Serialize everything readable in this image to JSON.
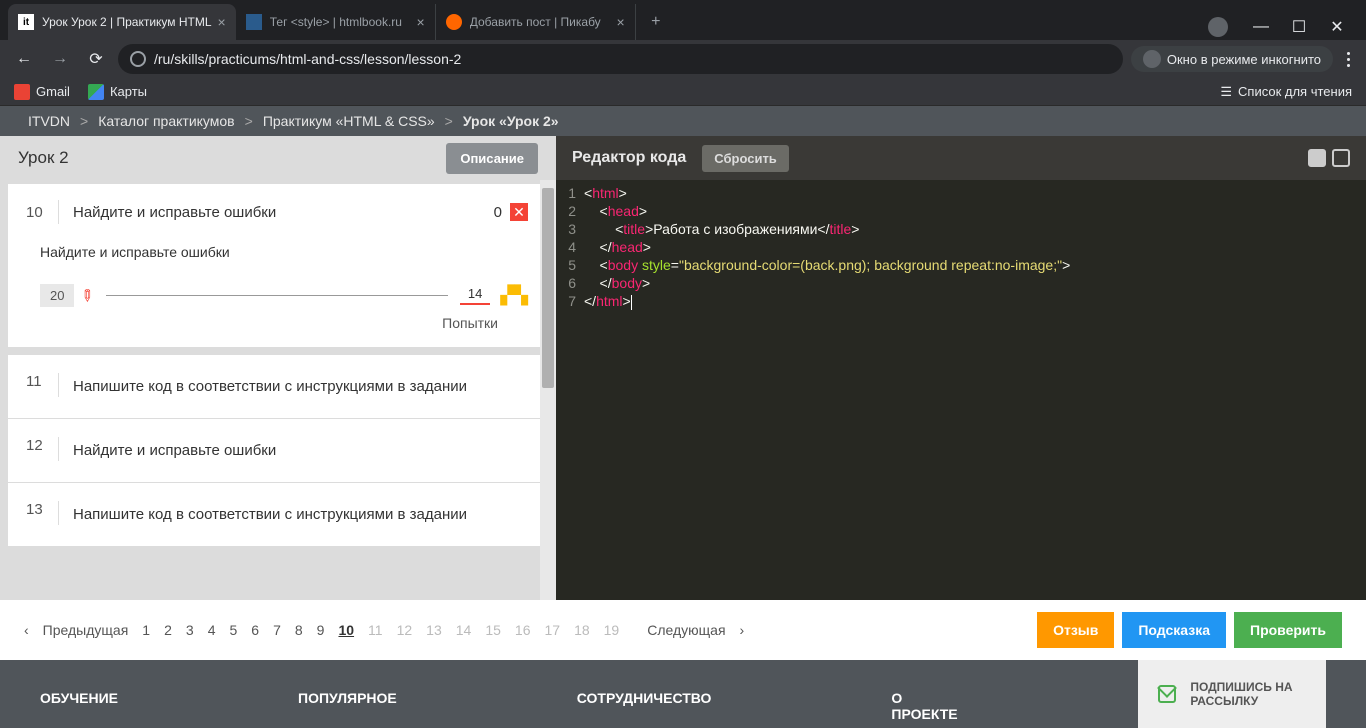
{
  "browser": {
    "tabs": [
      {
        "label": "Урок Урок 2 | Практикум HTML",
        "favicon": "it"
      },
      {
        "label": "Тег <style> | htmlbook.ru",
        "favicon": "star"
      },
      {
        "label": "Добавить пост | Пикабу",
        "favicon": "pik"
      }
    ],
    "url": "/ru/skills/practicums/html-and-css/lesson/lesson-2",
    "incognito": "Окно в режиме инкогнито",
    "bookmarks": [
      {
        "label": "Gmail"
      },
      {
        "label": "Карты"
      }
    ],
    "reading_list": "Список для чтения"
  },
  "breadcrumb": [
    "ITVDN",
    "Каталог практикумов",
    "Практикум «HTML & CSS»",
    "Урок «Урок 2»"
  ],
  "lesson": {
    "title": "Урок 2",
    "desc_btn": "Описание",
    "current": {
      "num": "10",
      "title": "Найдите и исправьте ошибки",
      "score": "0",
      "subtitle": "Найдите и исправьте ошибки",
      "progress": "20",
      "attempts": "14",
      "attempts_label": "Попытки"
    },
    "items": [
      {
        "num": "11",
        "title": "Напишите код в соответствии с инструкциями в задании"
      },
      {
        "num": "12",
        "title": "Найдите и исправьте ошибки"
      },
      {
        "num": "13",
        "title": "Напишите код в соответствии с инструкциями в задании"
      }
    ]
  },
  "editor": {
    "title": "Редактор кода",
    "reset": "Сбросить",
    "lines": [
      [
        {
          "c": "t-white",
          "t": "<"
        },
        {
          "c": "t-red",
          "t": "html"
        },
        {
          "c": "t-white",
          "t": ">"
        }
      ],
      [
        {
          "c": "t-white",
          "t": "    <"
        },
        {
          "c": "t-red",
          "t": "head"
        },
        {
          "c": "t-white",
          "t": ">"
        }
      ],
      [
        {
          "c": "t-white",
          "t": "        <"
        },
        {
          "c": "t-red",
          "t": "title"
        },
        {
          "c": "t-white",
          "t": ">Работа с изображениями</"
        },
        {
          "c": "t-red",
          "t": "title"
        },
        {
          "c": "t-white",
          "t": ">"
        }
      ],
      [
        {
          "c": "t-white",
          "t": "    </"
        },
        {
          "c": "t-red",
          "t": "head"
        },
        {
          "c": "t-white",
          "t": ">"
        }
      ],
      [
        {
          "c": "t-white",
          "t": "    <"
        },
        {
          "c": "t-red",
          "t": "body "
        },
        {
          "c": "t-green",
          "t": "style"
        },
        {
          "c": "t-white",
          "t": "="
        },
        {
          "c": "t-yellow",
          "t": "\"background-color=(back.png); background repeat:no-image;\""
        },
        {
          "c": "t-white",
          "t": ">"
        }
      ],
      [
        {
          "c": "t-white",
          "t": "    </"
        },
        {
          "c": "t-red",
          "t": "body"
        },
        {
          "c": "t-white",
          "t": ">"
        }
      ],
      [
        {
          "c": "t-white",
          "t": "</"
        },
        {
          "c": "t-red",
          "t": "html"
        },
        {
          "c": "t-white",
          "t": ">"
        }
      ]
    ]
  },
  "pagination": {
    "prev": "Предыдущая",
    "next": "Следующая",
    "pages": [
      "1",
      "2",
      "3",
      "4",
      "5",
      "6",
      "7",
      "8",
      "9",
      "10",
      "11",
      "12",
      "13",
      "14",
      "15",
      "16",
      "17",
      "18",
      "19"
    ],
    "current": "10",
    "disabled": [
      "11",
      "12",
      "13",
      "14",
      "15",
      "16",
      "17",
      "18",
      "19"
    ]
  },
  "actions": {
    "review": "Отзыв",
    "hint": "Подсказка",
    "check": "Проверить"
  },
  "footer": {
    "cols": [
      "ОБУЧЕНИЕ",
      "ПОПУЛЯРНОЕ",
      "СОТРУДНИЧЕСТВО",
      "О ПРОЕКТЕ"
    ],
    "subscribe": "ПОДПИШИСЬ НА РАССЫЛКУ"
  }
}
